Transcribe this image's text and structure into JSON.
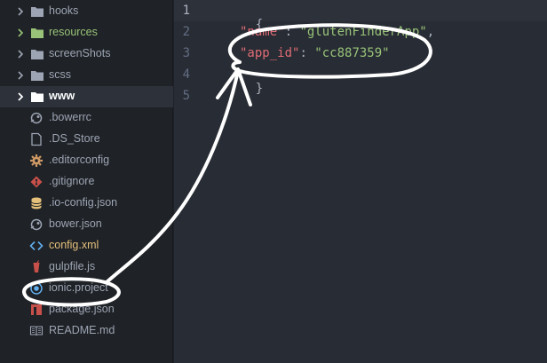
{
  "sidebar": {
    "items": [
      {
        "type": "folder",
        "label": "hooks",
        "icon": "folder-icon",
        "style": "normal"
      },
      {
        "type": "folder",
        "label": "resources",
        "icon": "folder-icon",
        "style": "green"
      },
      {
        "type": "folder",
        "label": "screenShots",
        "icon": "folder-icon",
        "style": "normal"
      },
      {
        "type": "folder",
        "label": "scss",
        "icon": "folder-icon",
        "style": "normal"
      },
      {
        "type": "folder",
        "label": "www",
        "icon": "folder-icon",
        "style": "white",
        "selected": true
      },
      {
        "type": "file",
        "label": ".bowerrc",
        "icon": "bower-icon"
      },
      {
        "type": "file",
        "label": ".DS_Store",
        "icon": "file-icon"
      },
      {
        "type": "file",
        "label": ".editorconfig",
        "icon": "gear-icon"
      },
      {
        "type": "file",
        "label": ".gitignore",
        "icon": "git-icon"
      },
      {
        "type": "file",
        "label": ".io-config.json",
        "icon": "database-icon"
      },
      {
        "type": "file",
        "label": "bower.json",
        "icon": "bower-icon"
      },
      {
        "type": "file",
        "label": "config.xml",
        "icon": "code-icon",
        "style": "orange"
      },
      {
        "type": "file",
        "label": "gulpfile.js",
        "icon": "gulp-icon"
      },
      {
        "type": "file",
        "label": "ionic.project",
        "icon": "ionic-icon"
      },
      {
        "type": "file",
        "label": "package.json",
        "icon": "npm-icon"
      },
      {
        "type": "file",
        "label": "README.md",
        "icon": "book-icon"
      }
    ]
  },
  "editor": {
    "line_numbers": [
      "1",
      "2",
      "3",
      "4",
      "5"
    ],
    "lines": {
      "l1_open": "{",
      "l2_key": "\"name\"",
      "l2_colon": ": ",
      "l2_value": "\"glutenFinderApp\"",
      "l2_comma": ",",
      "l3_key": "\"app_id\"",
      "l3_colon": ": ",
      "l3_value": "\"cc887359\"",
      "l4_close": "}"
    }
  },
  "colors": {
    "sidebar_bg": "#1f2226",
    "editor_bg": "#282c34",
    "string": "#98c379",
    "annotation": "#ffffff"
  }
}
